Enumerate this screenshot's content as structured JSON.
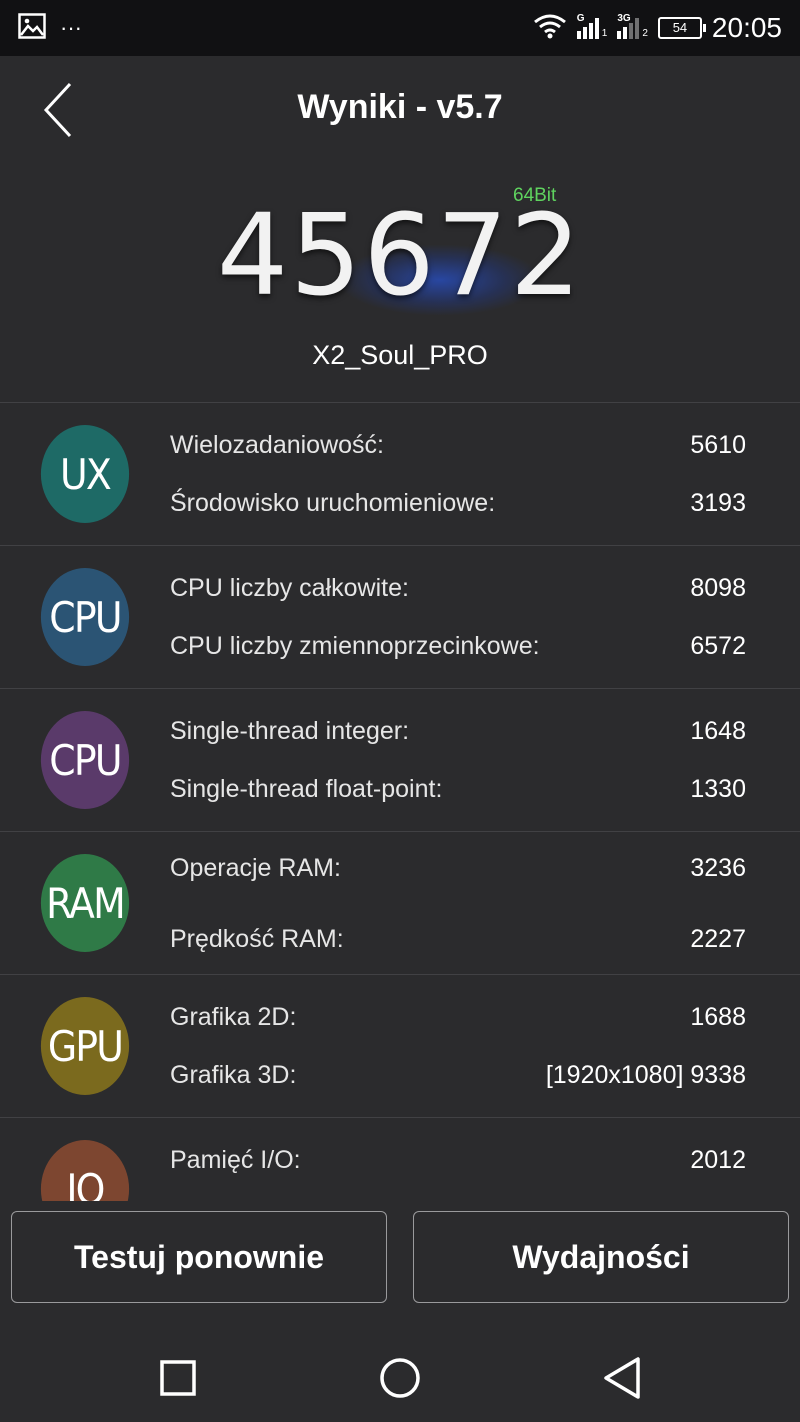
{
  "status_bar": {
    "time": "20:05",
    "battery": "54",
    "signal1_tag": "G",
    "signal1_sub": "1",
    "signal2_tag": "3G",
    "signal2_sub": "2",
    "overflow": "···",
    "icons": [
      "image-icon",
      "wifi-icon",
      "signal-icon",
      "battery-icon"
    ]
  },
  "header": {
    "title": "Wyniki - v5.7"
  },
  "score": {
    "value": "45672",
    "bit": "64Bit",
    "device": "X2_Soul_PRO"
  },
  "categories": [
    {
      "badge": "UX",
      "color": "#1e6a66",
      "items": [
        {
          "label": "Wielozadaniowość:",
          "value": "5610"
        },
        {
          "label": "Środowisko uruchomieniowe:",
          "value": "3193"
        }
      ]
    },
    {
      "badge": "CPU",
      "color": "#2b5474",
      "items": [
        {
          "label": "CPU liczby całkowite:",
          "value": "8098"
        },
        {
          "label": "CPU liczby zmiennoprzecinkowe:",
          "value": "6572"
        }
      ]
    },
    {
      "badge": "CPU",
      "color": "#5a3a6a",
      "items": [
        {
          "label": "Single-thread integer:",
          "value": "1648"
        },
        {
          "label": "Single-thread float-point:",
          "value": "1330"
        }
      ]
    },
    {
      "badge": "RAM",
      "color": "#2f7a47",
      "items": [
        {
          "label": "Operacje RAM:",
          "value": "3236"
        },
        {
          "label": "Prędkość RAM:",
          "value": "2227"
        }
      ]
    },
    {
      "badge": "GPU",
      "color": "#7b6a1e",
      "items": [
        {
          "label": "Grafika 2D:",
          "value": "1688"
        },
        {
          "label": "Grafika 3D:",
          "value": "[1920x1080] 9338"
        }
      ]
    },
    {
      "badge": "IO",
      "color": "#7d4630",
      "items": [
        {
          "label": "Pamięć I/O:",
          "value": "2012"
        }
      ]
    }
  ],
  "buttons": {
    "retest": "Testuj ponownie",
    "performance": "Wydajności"
  }
}
